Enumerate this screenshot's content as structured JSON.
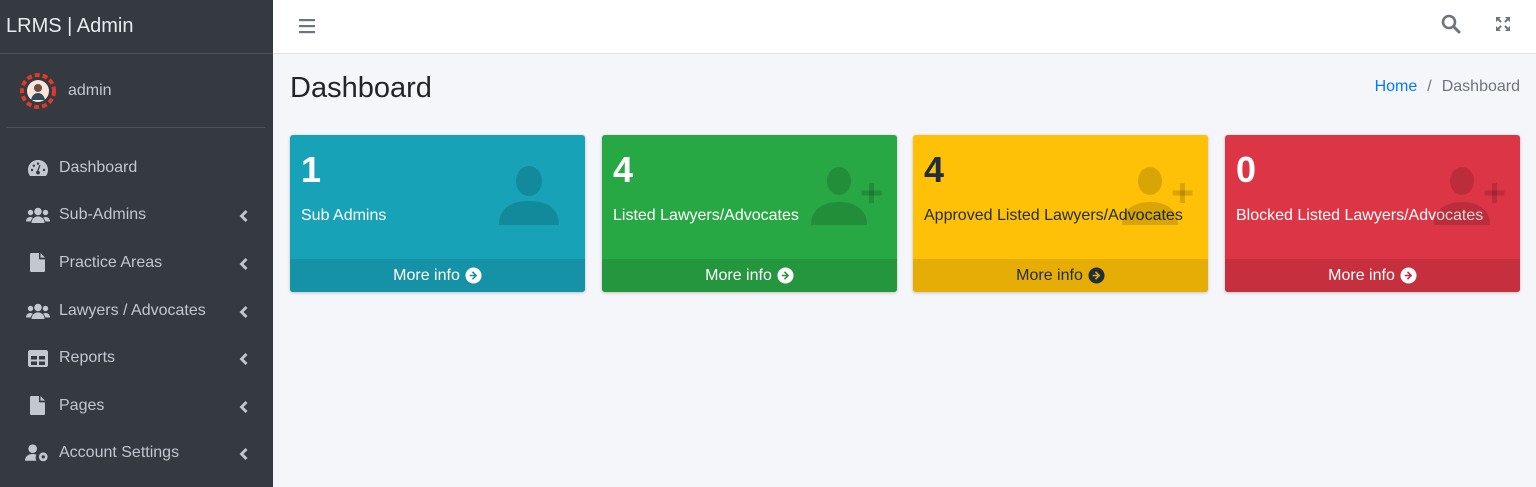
{
  "brand": {
    "title": "LRMS | Admin"
  },
  "user": {
    "name": "admin"
  },
  "sidebar": {
    "items": [
      {
        "label": "Dashboard",
        "icon": "tachometer-icon",
        "has_children": false
      },
      {
        "label": "Sub-Admins",
        "icon": "users-icon",
        "has_children": true
      },
      {
        "label": "Practice Areas",
        "icon": "file-icon",
        "has_children": true
      },
      {
        "label": "Lawyers / Advocates",
        "icon": "users-icon",
        "has_children": true
      },
      {
        "label": "Reports",
        "icon": "table-icon",
        "has_children": true
      },
      {
        "label": "Pages",
        "icon": "file-icon",
        "has_children": true
      },
      {
        "label": "Account Settings",
        "icon": "user-cog-icon",
        "has_children": true
      }
    ]
  },
  "topbar": {
    "menu_icon": "hamburger-icon",
    "search_icon": "search-icon",
    "fullscreen_icon": "expand-icon"
  },
  "header": {
    "title": "Dashboard"
  },
  "breadcrumb": {
    "home": "Home",
    "separator": "/",
    "current": "Dashboard"
  },
  "boxes": [
    {
      "value": "1",
      "label": "Sub Admins",
      "footer": "More info",
      "color": "#17a2b8",
      "icon": "user-icon"
    },
    {
      "value": "4",
      "label": "Listed Lawyers/Advocates",
      "footer": "More info",
      "color": "#28a745",
      "icon": "user-plus-icon"
    },
    {
      "value": "4",
      "label": "Approved Listed Lawyers/Advocates",
      "footer": "More info",
      "color": "#ffc107",
      "icon": "user-plus-icon"
    },
    {
      "value": "0",
      "label": "Blocked Listed Lawyers/Advocates",
      "footer": "More info",
      "color": "#dc3545",
      "icon": "user-plus-icon"
    }
  ]
}
